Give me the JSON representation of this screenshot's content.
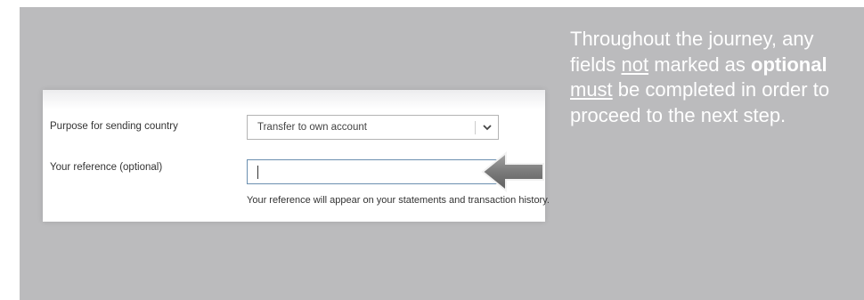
{
  "form": {
    "purpose_label": "Purpose for sending country",
    "purpose_value": "Transfer to own account",
    "reference_label": "Your reference (optional)",
    "reference_value": "",
    "reference_hint": "Your reference will appear on your statements and transaction history."
  },
  "note": {
    "part1": "Throughout the journey, any fields ",
    "part2": "not",
    "part3": " marked as ",
    "part4": "optional",
    "part5": " ",
    "part6": "must",
    "part7": " be completed in order to proceed to the next step."
  },
  "colors": {
    "panel_background": "#bbbbbd",
    "note_text": "#ffffff",
    "input_border_focus": "#6b8fb0",
    "arrow": "#808080"
  },
  "icons": {
    "select_chevron": "chevron-down-icon",
    "pointer": "arrow-left-icon"
  }
}
